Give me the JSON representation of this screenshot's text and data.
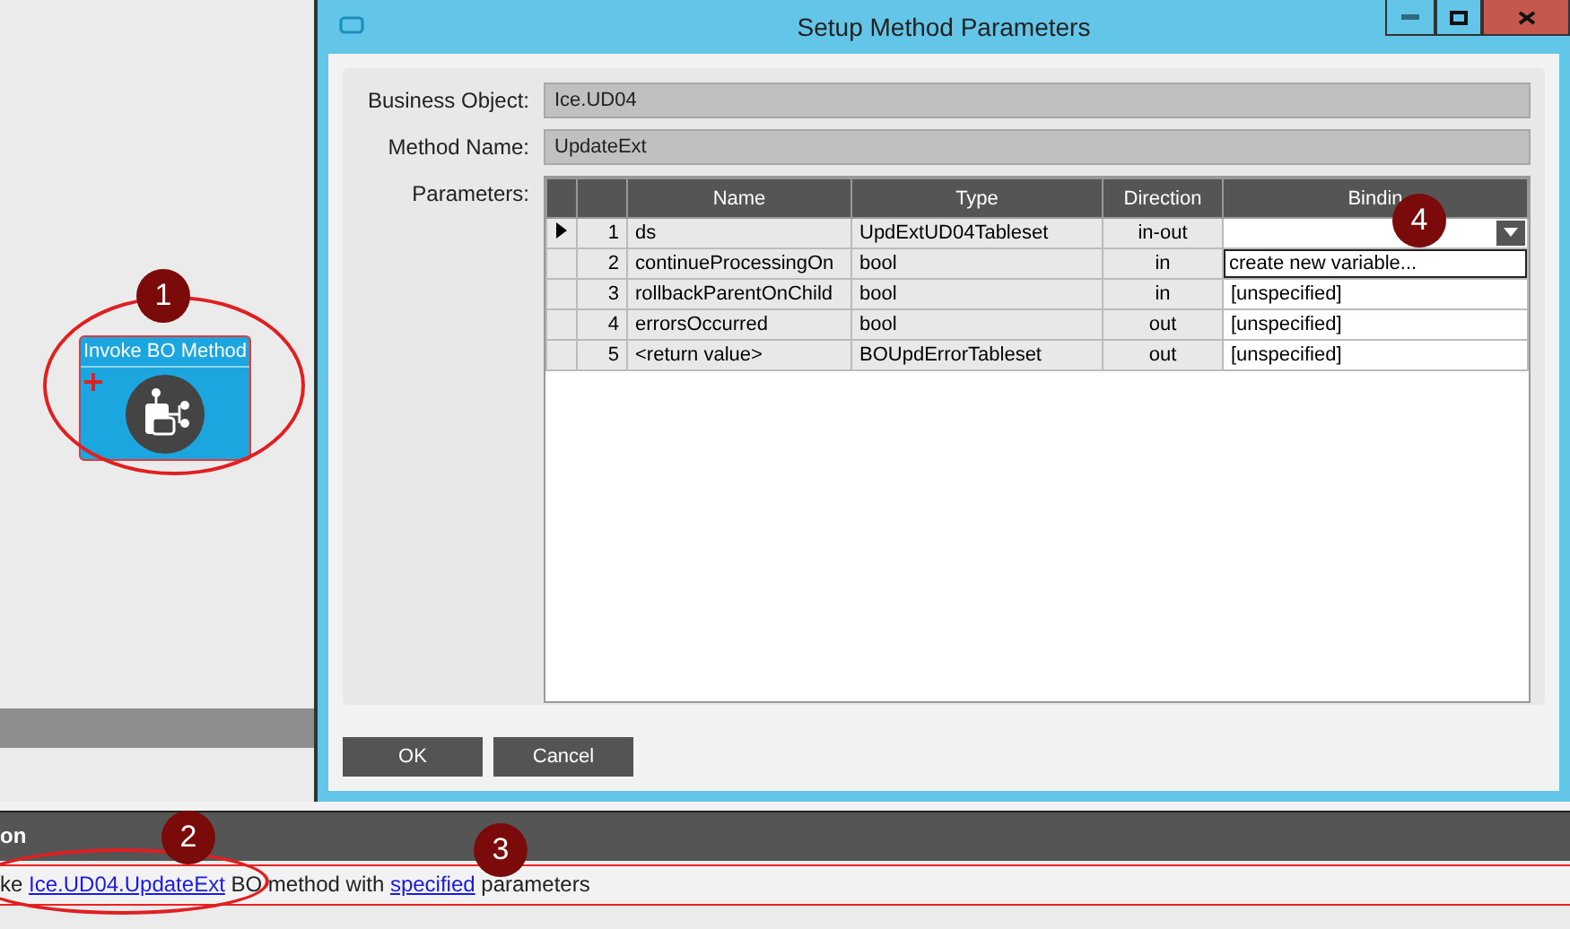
{
  "canvas": {
    "node": {
      "title": "Invoke BO Method"
    }
  },
  "dialog": {
    "title": "Setup Method Parameters",
    "fields": [
      {
        "label": "Business Object:",
        "value": "Ice.UD04"
      },
      {
        "label": "Method Name:",
        "value": "UpdateExt"
      }
    ],
    "parameters_label": "Parameters:",
    "columns": [
      "Name",
      "Type",
      "Direction",
      "Bindin"
    ],
    "rows": [
      {
        "selected": true,
        "num": "1",
        "name": "ds",
        "type": "UpdExtUD04Tableset",
        "direction": "in-out",
        "kind": "combo"
      },
      {
        "selected": false,
        "num": "2",
        "name": "continueProcessingOn",
        "type": "bool",
        "direction": "in",
        "kind": "covered"
      },
      {
        "selected": false,
        "num": "3",
        "name": "rollbackParentOnChild",
        "type": "bool",
        "direction": "in",
        "kind": "text",
        "binding": "[unspecified]"
      },
      {
        "selected": false,
        "num": "4",
        "name": "errorsOccurred",
        "type": "bool",
        "direction": "out",
        "kind": "text",
        "binding": "[unspecified]"
      },
      {
        "selected": false,
        "num": "5",
        "name": "<return value>",
        "type": "BOUpdErrorTableset",
        "direction": "out",
        "kind": "text",
        "binding": "[unspecified]"
      }
    ],
    "dropdown_items": [
      "create new variable..."
    ],
    "buttons": [
      "OK",
      "Cancel"
    ]
  },
  "panel": {
    "header": "on",
    "sentence": [
      {
        "kind": "text",
        "text": "ke "
      },
      {
        "kind": "link",
        "text": "Ice.UD04.UpdateExt"
      },
      {
        "kind": "text",
        "text": " BO method with "
      },
      {
        "kind": "link",
        "text": "specified"
      },
      {
        "kind": "text",
        "text": " parameters"
      }
    ]
  },
  "badges": [
    "1",
    "2",
    "3",
    "4"
  ]
}
